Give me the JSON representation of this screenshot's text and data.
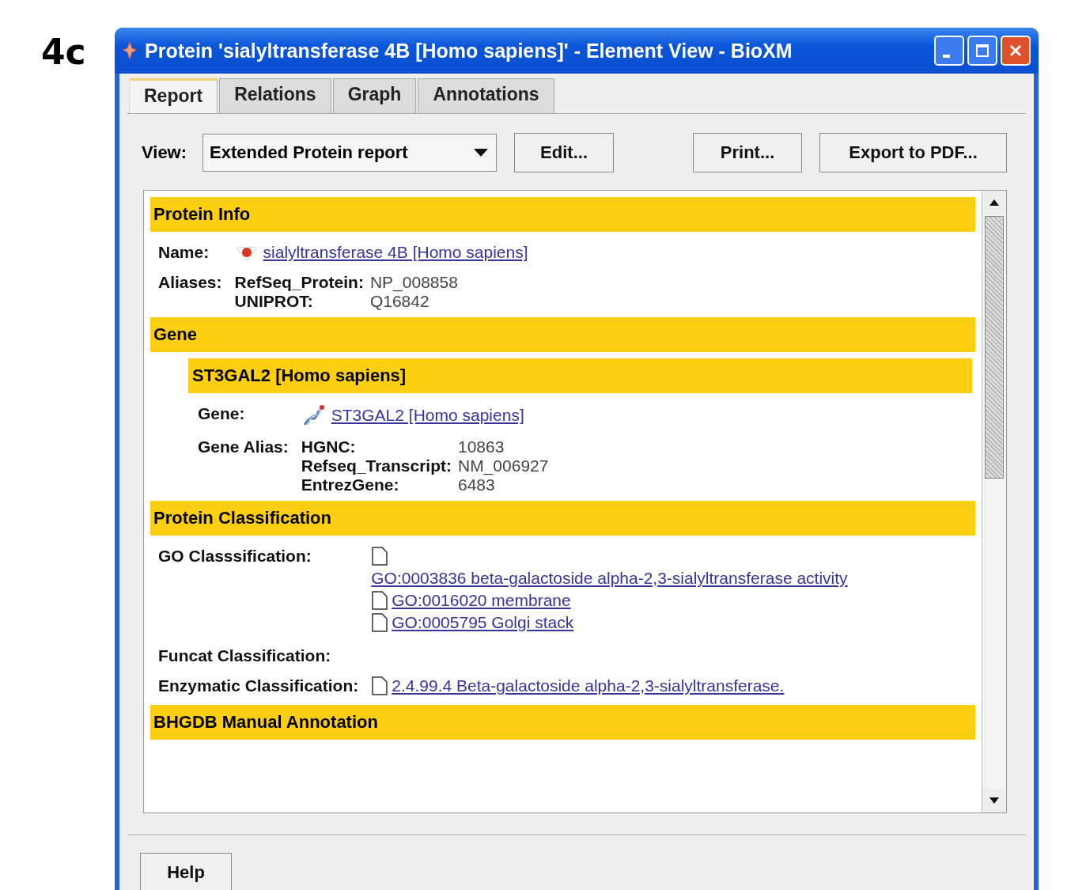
{
  "figure_label": "4c",
  "window": {
    "title": "Protein 'sialyltransferase 4B [Homo sapiens]' - Element View - BioXM"
  },
  "tabs": [
    {
      "label": "Report",
      "selected": true
    },
    {
      "label": "Relations",
      "selected": false
    },
    {
      "label": "Graph",
      "selected": false
    },
    {
      "label": "Annotations",
      "selected": false
    }
  ],
  "toolbar": {
    "view_label": "View:",
    "view_dropdown": {
      "value": "Extended Protein report"
    },
    "buttons": [
      "Edit...",
      "Print...",
      "Export to PDF..."
    ]
  },
  "report": {
    "sections": [
      {
        "title": "Protein Info",
        "rows": [
          {
            "kind": "protein_link",
            "label": "Name:",
            "link": "sialyltransferase 4B [Homo sapiens]"
          },
          {
            "kind": "aliases",
            "label": "Aliases:",
            "entries": [
              {
                "key": "RefSeq_Protein:",
                "value": "NP_008858"
              },
              {
                "key": "UNIPROT:",
                "value": "Q16842"
              }
            ]
          }
        ]
      },
      {
        "title": "Gene",
        "subsections": [
          {
            "title": "ST3GAL2 [Homo sapiens]",
            "rows": [
              {
                "kind": "gene_link",
                "label": "Gene:",
                "link": "ST3GAL2 [Homo sapiens]"
              },
              {
                "kind": "aliases",
                "label": "Gene Alias:",
                "entries": [
                  {
                    "key": "HGNC:",
                    "value": "10863"
                  },
                  {
                    "key": "Refseq_Transcript:",
                    "value": "NM_006927"
                  },
                  {
                    "key": "EntrezGene:",
                    "value": "6483"
                  }
                ]
              }
            ]
          }
        ]
      },
      {
        "title": "Protein Classification",
        "rows": [
          {
            "kind": "doc_links",
            "label": "GO Classsification:",
            "links": [
              "GO:0003836 beta-galactoside alpha-2,3-sialyltransferase activity",
              "GO:0016020 membrane",
              "GO:0005795 Golgi stack"
            ]
          },
          {
            "kind": "doc_links",
            "label": "Funcat Classification:"
          },
          {
            "kind": "doc_links",
            "label": "Enzymatic Classification:",
            "links": [
              "2.4.99.4 Beta-galactoside alpha-2,3-sialyltransferase."
            ]
          }
        ]
      },
      {
        "title": "BHGDB Manual Annotation"
      }
    ]
  },
  "footer": {
    "buttons": [
      "Help"
    ]
  }
}
